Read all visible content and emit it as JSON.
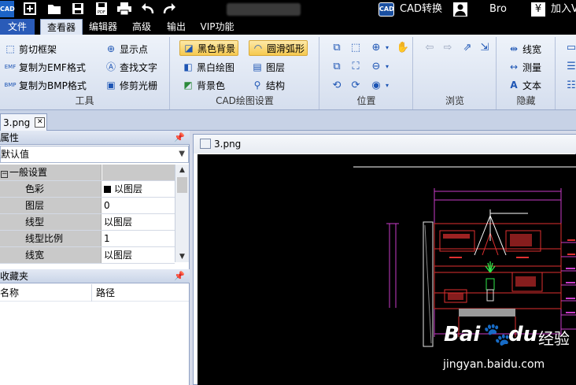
{
  "titlebar": {
    "app_logo": "CAD",
    "cad_badge": "CAD",
    "cad_convert": "CAD转换",
    "user": "Bro",
    "join": "加入V",
    "icons": [
      "new-icon",
      "open-folder-icon",
      "save-icon",
      "save-pdf-icon",
      "print-icon",
      "undo-icon",
      "redo-icon"
    ]
  },
  "menu": {
    "items": [
      "文件",
      "查看器",
      "编辑器",
      "高级",
      "输出",
      "VIP功能"
    ],
    "active": "查看器"
  },
  "ribbon": {
    "tools": {
      "label": "工具",
      "buttons": [
        "剪切框架",
        "复制为EMF格式",
        "复制为BMP格式",
        "显示点",
        "查找文字",
        "修剪光栅"
      ]
    },
    "cad_settings": {
      "label": "CAD绘图设置",
      "buttons": [
        "黑色背景",
        "黑白绘图",
        "背景色",
        "圆滑弧形",
        "图层",
        "结构"
      ],
      "selected": [
        "黑色背景",
        "圆滑弧形"
      ]
    },
    "position": {
      "label": "位置"
    },
    "browse": {
      "label": "浏览"
    },
    "hide": {
      "label": "隐藏",
      "buttons": [
        "线宽",
        "测量",
        "文本"
      ]
    }
  },
  "tabs": {
    "doc_tab": "3.png"
  },
  "properties": {
    "title": "属性",
    "combo_value": "默认值",
    "section": "一般设置",
    "rows": [
      {
        "key": "色彩",
        "value": "以图层"
      },
      {
        "key": "图层",
        "value": "0"
      },
      {
        "key": "线型",
        "value": "以图层"
      },
      {
        "key": "线型比例",
        "value": "1"
      },
      {
        "key": "线宽",
        "value": "以图层"
      }
    ]
  },
  "favorites": {
    "title": "收藏夹",
    "col_name": "名称",
    "col_path": "路径"
  },
  "document": {
    "title": "3.png"
  },
  "watermark": {
    "brand_bai": "Bai",
    "brand_du": "du",
    "brand_jingyan": "经验",
    "url": "jingyan.baidu.com"
  }
}
